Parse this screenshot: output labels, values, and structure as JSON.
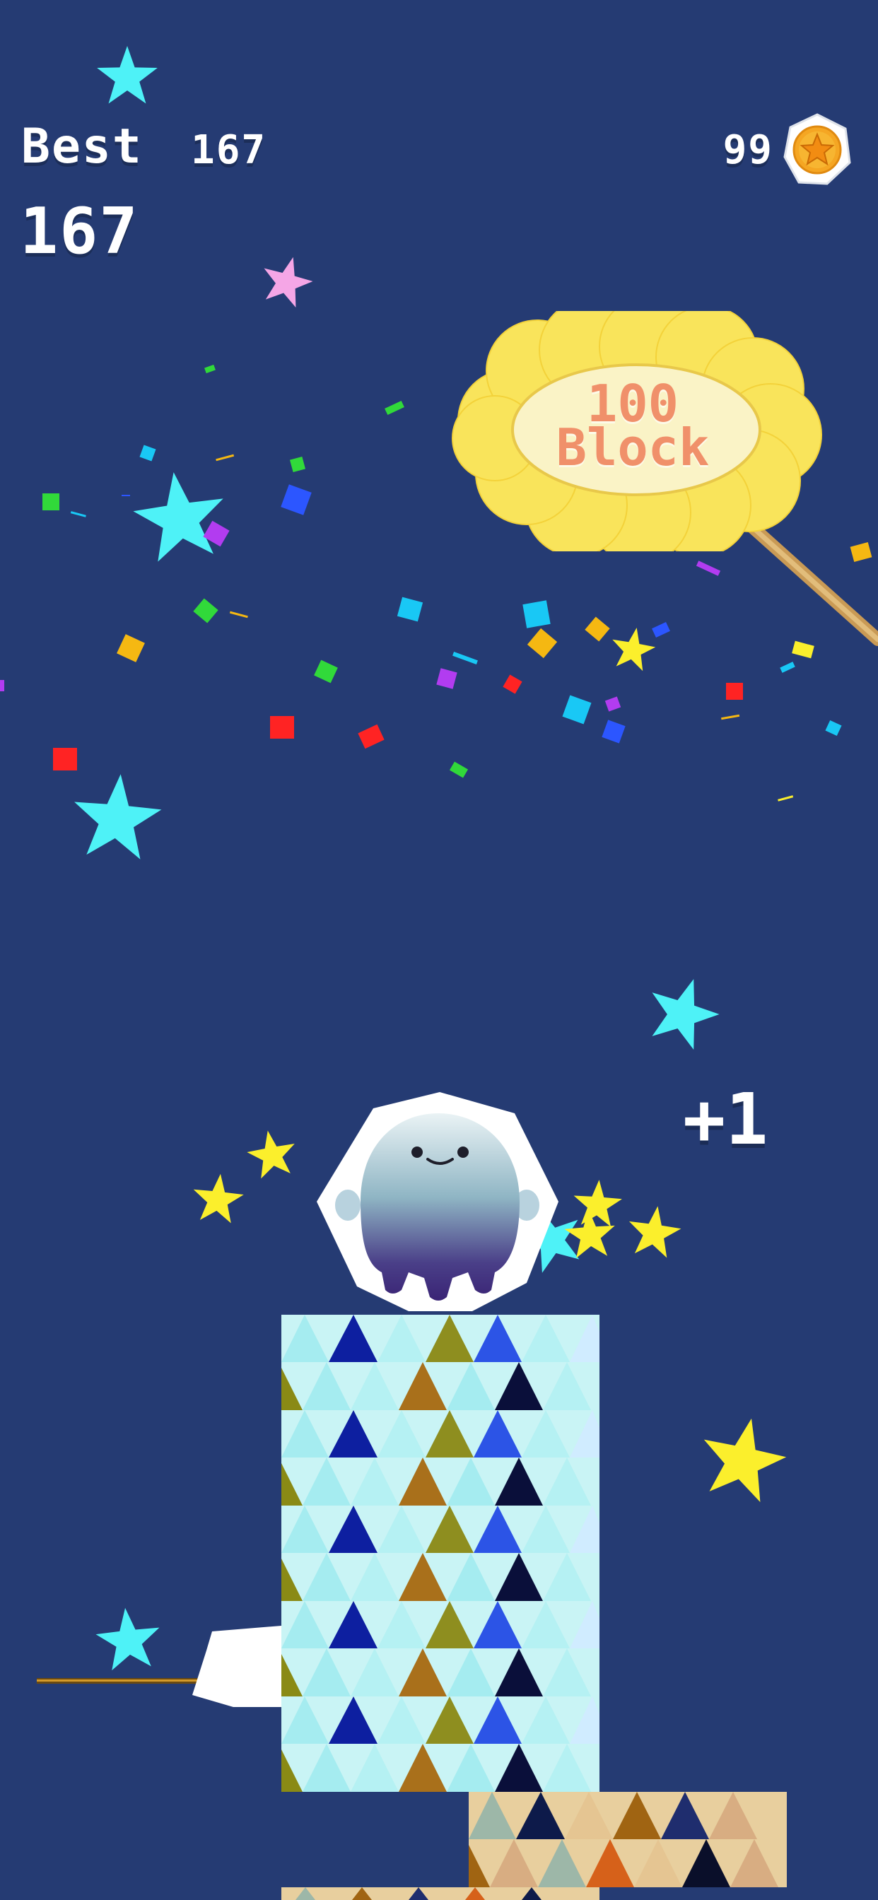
{
  "hud": {
    "best_label": "Best",
    "best_score": "167",
    "current_score": "167",
    "coins": "99",
    "coin_icon": "star-coin-icon"
  },
  "popup": {
    "score_gain": "+1"
  },
  "milestone": {
    "line1": "100",
    "line2": "Block"
  },
  "colors": {
    "background": "#253b73",
    "coin_gold": "#f5a623",
    "sign_yellow": "#f9e45b",
    "sign_text": "#f0906a",
    "star_cyan": "#4ef2f7",
    "star_yellow": "#fbef2c",
    "star_pink": "#f5a6e6"
  }
}
